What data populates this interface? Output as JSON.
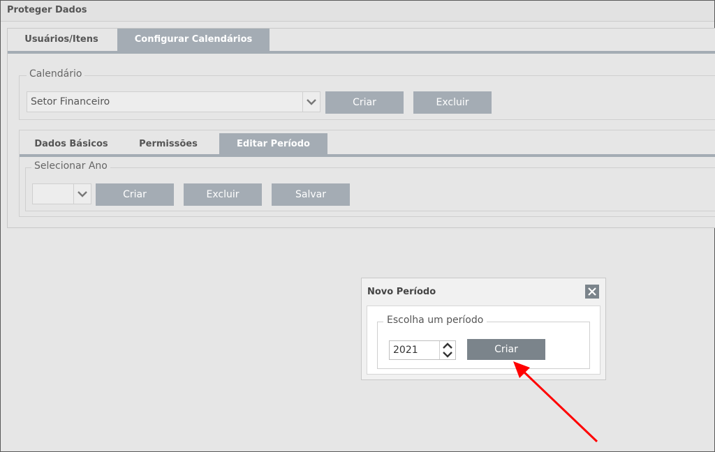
{
  "window": {
    "title": "Proteger Dados"
  },
  "main_tabs": [
    {
      "label": "Usuários/Itens",
      "active": false
    },
    {
      "label": "Configurar Calendários",
      "active": true
    }
  ],
  "calendar": {
    "legend": "Calendário",
    "selected": "Setor Financeiro",
    "create_label": "Criar",
    "delete_label": "Excluir"
  },
  "sub_tabs": [
    {
      "label": "Dados Básicos",
      "active": false
    },
    {
      "label": "Permissões",
      "active": false
    },
    {
      "label": "Editar Período",
      "active": true
    }
  ],
  "year": {
    "legend": "Selecionar Ano",
    "selected": "",
    "create_label": "Criar",
    "delete_label": "Excluir",
    "save_label": "Salvar"
  },
  "modal": {
    "title": "Novo Período",
    "legend": "Escolha um período",
    "period_value": "2021",
    "create_label": "Criar"
  },
  "colors": {
    "accent": "#a4acb4",
    "modal_button": "#7b848b",
    "annotation_arrow": "#ff0000"
  }
}
